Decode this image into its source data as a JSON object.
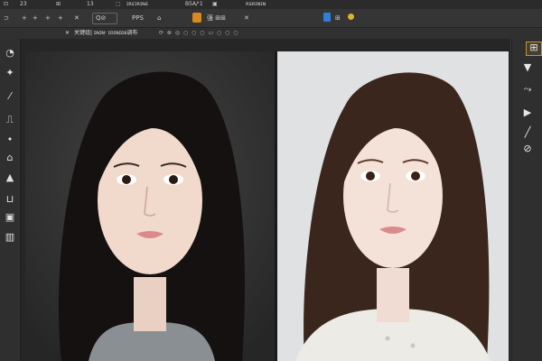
{
  "menubar": {
    "items": [
      "⊡",
      "23",
      "⊞",
      "13",
      "⬚",
      "ɪʀɛɪʀɪɴᴇ",
      "B5A/ᵗ1",
      "▣",
      "ʀsʀɪɴɪɴ"
    ]
  },
  "optionsbar": {
    "zoom_label": "Q⊘",
    "pps_label": "PPS",
    "ps_text": "强 ⊞⊞",
    "home_icon": "⌂",
    "icons_left": [
      "⊃",
      "+",
      "+",
      "+",
      "+"
    ],
    "close_symbol": "✕",
    "blue_badge_icon": "⊞",
    "yellow_icon": "●"
  },
  "tabbar": {
    "tab_close": "✕",
    "tab_title": "关键组| ɪɴɪɴ· ɪᴏɪɴɪᴅᴇ调布",
    "tab_icons": "⟳ ⊗ ◎ ○ ○ ○ ▭ ○ ○ ○"
  },
  "lefttools": [
    "◔",
    "✦",
    "⁄",
    "⎍",
    "•",
    "⌂",
    "▲",
    "⊔",
    "▣",
    "▥"
  ],
  "righttools": [
    "⊞",
    "▼",
    "⤳",
    "▶",
    "╱",
    "⊘"
  ],
  "colors": {
    "accent": "#d9891f",
    "blue": "#2f7fd6",
    "panel_bg": "#2f2f2f",
    "canvas_bg": "#262626",
    "left_photo_bg": "#2e2e2e",
    "right_photo_bg": "#dfe1e3",
    "hair_dark": "#141110",
    "hair_brown": "#3a261c",
    "skin": "#f1d9cc",
    "lips": "#d98a8a",
    "sweater_grey": "#8a8f94",
    "sweater_white": "#ecebe6"
  }
}
